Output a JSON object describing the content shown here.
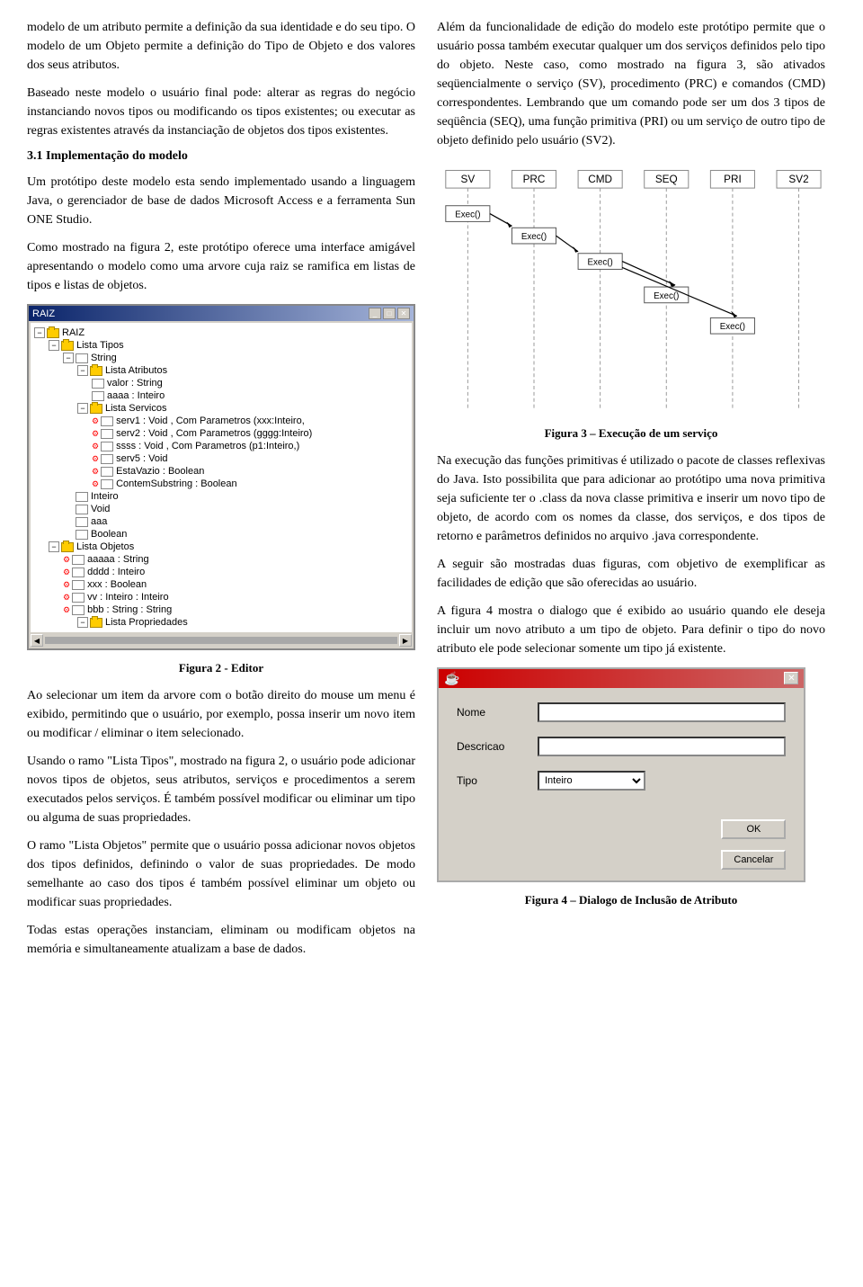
{
  "left": {
    "para1": "modelo de um atributo permite a definição da sua identidade e do seu tipo. O modelo de um Objeto permite a definição do Tipo de Objeto e dos valores dos seus atributos.",
    "para2": "Baseado neste modelo o usuário final pode: alterar as regras do negócio instanciando novos tipos ou modificando os tipos existentes; ou executar as regras existentes através da instanciação de objetos dos tipos existentes.",
    "section_title": "3.1 Implementação do modelo",
    "para3": "Um protótipo deste modelo esta sendo implementado usando a linguagem Java, o gerenciador de base de dados Microsoft Access e a ferramenta Sun ONE Studio.",
    "para4": "Como mostrado na figura 2, este protótipo oferece uma interface amigável apresentando o modelo como uma arvore cuja raiz se ramifica em listas de tipos e listas de objetos.",
    "fig2_caption": "Figura 2 - Editor",
    "fig2_desc1": "Ao selecionar um item da arvore com o botão direito do mouse um menu é exibido, permitindo que o usuário, por exemplo, possa inserir um novo item ou  modificar / eliminar o item selecionado.",
    "fig2_desc2": "Usando o ramo \"Lista Tipos\", mostrado na figura 2, o usuário pode adicionar novos tipos de objetos, seus atributos, serviços e procedimentos a serem executados pelos serviços. É também possível modificar ou eliminar um tipo ou alguma de suas propriedades.",
    "fig2_desc3": "O ramo \"Lista Objetos\" permite que o usuário possa adicionar novos objetos dos tipos definidos, definindo o valor de suas propriedades. De modo semelhante ao caso dos tipos é também possível eliminar um objeto ou modificar suas propriedades.",
    "fig2_desc4": "Todas estas operações instanciam, eliminam ou modificam objetos na memória e simultaneamente atualizam a base de dados."
  },
  "right": {
    "para1": "Além da funcionalidade de edição do modelo este protótipo permite que o usuário possa também executar qualquer um dos serviços definidos pelo tipo do objeto. Neste caso, como mostrado na figura 3, são ativados seqüencialmente o serviço (SV), procedimento (PRC) e comandos (CMD) correspondentes. Lembrando que um comando pode ser um dos 3 tipos de seqüência (SEQ), uma função primitiva (PRI) ou um serviço de outro tipo de objeto definido pelo usuário (SV2).",
    "fig3_caption": "Figura 3 – Execução de um serviço",
    "fig3_labels": [
      "SV",
      "PRC",
      "CMD",
      "SEQ",
      "PRI",
      "SV2"
    ],
    "fig3_exec_labels": [
      "Exec()",
      "Exec()",
      "Exec()",
      "Exec()",
      "Exec()"
    ],
    "para2": "Na execução das funções primitivas é utilizado o pacote de classes reflexivas do Java. Isto possibilita que para adicionar ao protótipo uma nova primitiva seja suficiente ter o .class  da nova classe primitiva e inserir um novo tipo de objeto, de acordo com os nomes da classe, dos serviços, e dos tipos de retorno e  parâmetros definidos no arquivo .java correspondente.",
    "para3": "A seguir são mostradas duas figuras, com objetivo de exemplificar as facilidades de edição que são oferecidas ao usuário.",
    "para4": "A figura 4 mostra o dialogo que é exibido ao usuário quando ele deseja incluir um novo atributo a um tipo de objeto. Para definir o tipo do novo atributo ele pode selecionar somente um tipo já existente.",
    "fig4_caption": "Figura 4 – Dialogo de Inclusão de Atributo",
    "fig4_dialog_title": "",
    "fig4_nome_label": "Nome",
    "fig4_descricao_label": "Descricao",
    "fig4_tipo_label": "Tipo",
    "fig4_tipo_value": "Inteiro",
    "fig4_ok_btn": "OK",
    "fig4_cancel_btn": "Cancelar"
  },
  "editor": {
    "title": "RAIZ",
    "tree": [
      {
        "label": "RAIZ",
        "level": 0,
        "type": "root"
      },
      {
        "label": "Lista Tipos",
        "level": 1,
        "type": "folder"
      },
      {
        "label": "String",
        "level": 2,
        "type": "item"
      },
      {
        "label": "Lista Atributos",
        "level": 3,
        "type": "folder"
      },
      {
        "label": "valor : String",
        "level": 4,
        "type": "item"
      },
      {
        "label": "aaaa : Inteiro",
        "level": 4,
        "type": "item"
      },
      {
        "label": "Lista Servicos",
        "level": 3,
        "type": "folder"
      },
      {
        "label": "serv1 : Void , Com Parametros (xxx:Inteiro,",
        "level": 4,
        "type": "service"
      },
      {
        "label": "serv2 : Void , Com Parametros (gggg:Inteiro)",
        "level": 4,
        "type": "service"
      },
      {
        "label": "ssss : Void , Com Parametros (p1:Inteiro,)",
        "level": 4,
        "type": "service"
      },
      {
        "label": "serv5 : Void",
        "level": 4,
        "type": "service"
      },
      {
        "label": "EstaVazio : Boolean",
        "level": 4,
        "type": "service"
      },
      {
        "label": "ContemSubstring : Boolean",
        "level": 4,
        "type": "service"
      },
      {
        "label": "Inteiro",
        "level": 2,
        "type": "item"
      },
      {
        "label": "Void",
        "level": 2,
        "type": "item"
      },
      {
        "label": "aaa",
        "level": 2,
        "type": "item"
      },
      {
        "label": "Boolean",
        "level": 2,
        "type": "item"
      },
      {
        "label": "Lista Objetos",
        "level": 1,
        "type": "folder"
      },
      {
        "label": "aaaaa : String",
        "level": 2,
        "type": "service"
      },
      {
        "label": "dddd : Inteiro",
        "level": 2,
        "type": "service"
      },
      {
        "label": "xxx : Boolean",
        "level": 2,
        "type": "service"
      },
      {
        "label": "vv : Inteiro : Inteiro",
        "level": 2,
        "type": "service"
      },
      {
        "label": "bbb : String : String",
        "level": 2,
        "type": "service"
      },
      {
        "label": "Lista Propriedades",
        "level": 3,
        "type": "folder"
      }
    ]
  }
}
